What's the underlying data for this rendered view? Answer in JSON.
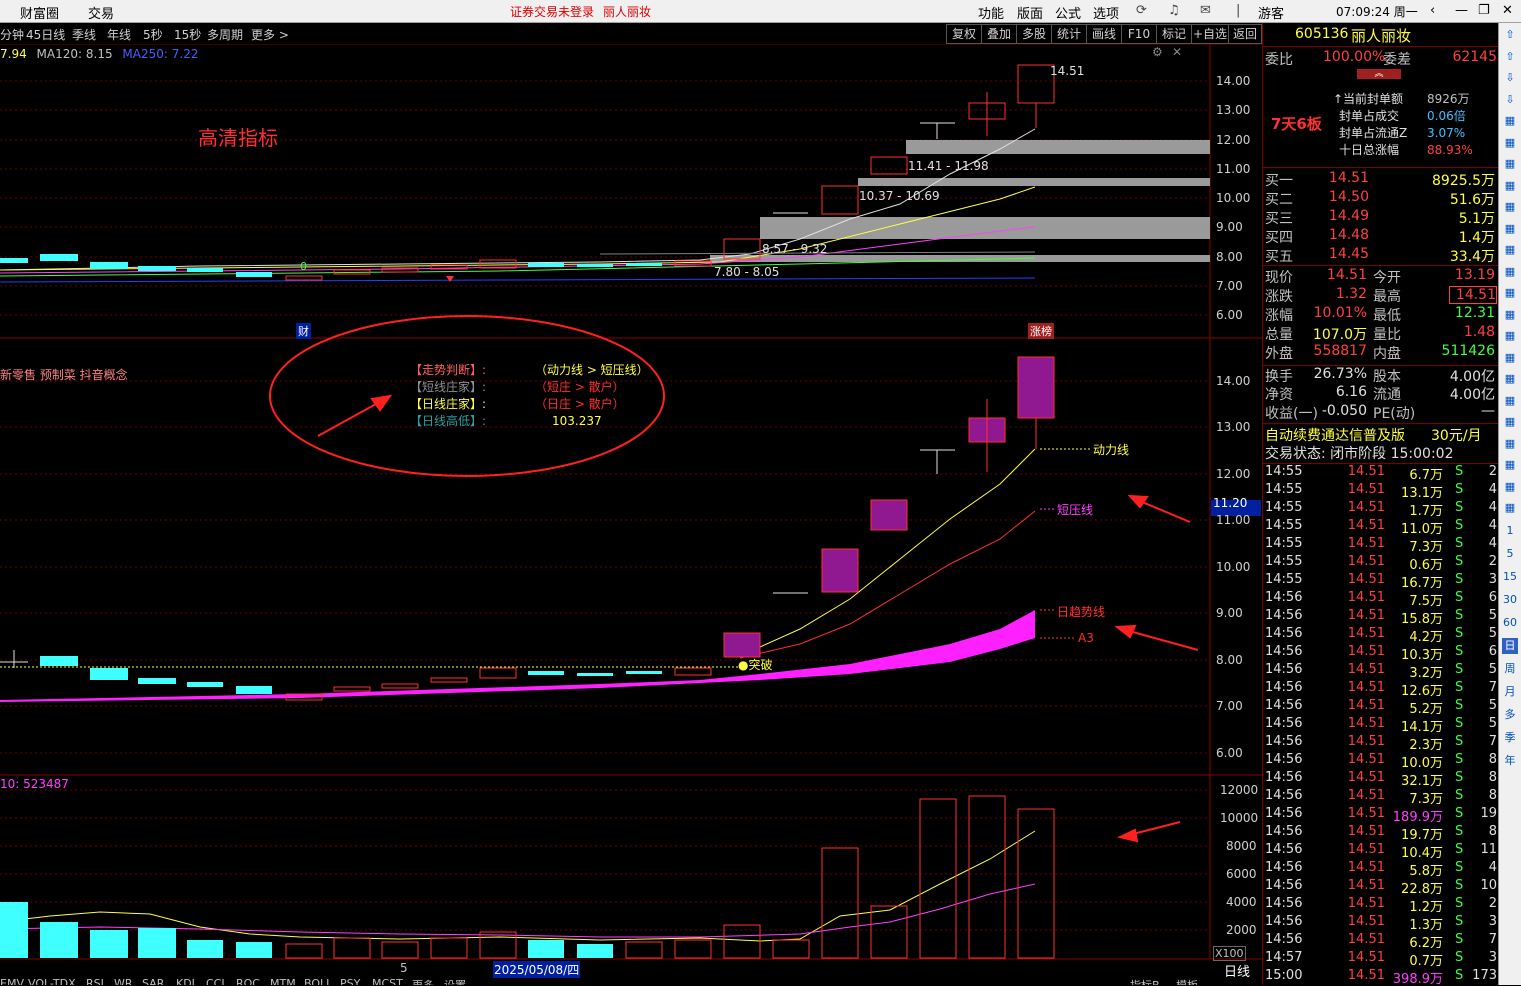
{
  "menu": {
    "left": [
      "财富圈",
      "交易"
    ],
    "alert": "证券交易未登录",
    "stock_name_top": "丽人丽妆",
    "right": [
      "功能",
      "版面",
      "公式",
      "选项"
    ],
    "user": "游客",
    "clock": "07:09:24 周一"
  },
  "toolbar": {
    "periods": [
      "分钟",
      "45日线",
      "季线",
      "年线",
      "5秒",
      "15秒",
      "多周期",
      "更多 >"
    ],
    "buttons": [
      "复权",
      "叠加",
      "多股",
      "统计",
      "画线",
      "F10",
      "标记",
      "+自选",
      "返回"
    ]
  },
  "main_chart": {
    "ma_legend": [
      {
        "text": "7.94",
        "color": "#ffff40"
      },
      {
        "text": "MA120: 8.15",
        "color": "#c0c0c0"
      },
      {
        "text": "MA250: 7.22",
        "color": "#4060ff"
      }
    ],
    "watermark": "高清指标",
    "high_label": "14.51",
    "zones": [
      "11.41 - 11.98",
      "10.37 - 10.69",
      "8.57 - 9.32",
      "7.80 - 8.05"
    ],
    "y_ticks": [
      "14.00",
      "13.00",
      "12.00",
      "11.00",
      "10.00",
      "9.00",
      "8.00",
      "7.00",
      "6.00"
    ],
    "event_cai": "财",
    "event_zhang": "涨榜"
  },
  "indicator_chart": {
    "concepts": "新零售 预制菜 抖音概念",
    "rows": [
      {
        "label": "【走势判断】:",
        "value": "（动力线 > 短压线）",
        "lc": "#ff6060",
        "vc": "#ffff40"
      },
      {
        "label": "【短线庄家】:",
        "value": "（短庄 > 散户）",
        "lc": "#909090",
        "vc": "#ff3030"
      },
      {
        "label": "【日线庄家】:",
        "value": "（日庄 > 散户）",
        "lc": "#ffff40",
        "vc": "#ff3030"
      },
      {
        "label": "【日线高低】:",
        "value": "103.237",
        "lc": "#30a0a0",
        "vc": "#ffff40"
      }
    ],
    "labels": {
      "dongli": "动力线",
      "duanya": "短压线",
      "rishi": "日趋势线",
      "a3": "A3",
      "tupo": "突破"
    },
    "price_tag": "11.20",
    "y_ticks": [
      "14.00",
      "13.00",
      "12.00",
      "11.00",
      "10.00",
      "9.00",
      "8.00",
      "7.00",
      "6.00"
    ]
  },
  "volume_chart": {
    "legend": "10: 523487",
    "y_ticks": [
      "12000",
      "10000",
      "8000",
      "6000",
      "4000",
      "2000"
    ],
    "unit": "X100",
    "date_marker": "2025/05/08/四",
    "month_marker": "5",
    "period": "日线",
    "bottom_tabs": [
      "EMV",
      "VOL-TDX",
      "RSI",
      "WR",
      "SAR",
      "KDJ",
      "CCI",
      "ROC",
      "MTM",
      "BOLL",
      "PSY",
      "MCST",
      "更多",
      "设置"
    ],
    "bottom_right": [
      "指标B",
      "模板"
    ]
  },
  "quote": {
    "code": "605136",
    "name": "丽人丽妆",
    "weibi_label": "委比",
    "weibi": "100.00%",
    "weicha_label": "委差",
    "weicha": "62145",
    "streak": "7天6板",
    "seal": [
      {
        "label": "↑当前封单额",
        "value": "8926万",
        "vc": "#c0c0c0"
      },
      {
        "label": "封单占成交",
        "value": "0.06倍",
        "vc": "#40c0ff"
      },
      {
        "label": "封单占流通Z",
        "value": "3.07%",
        "vc": "#40c0ff"
      },
      {
        "label": "十日总涨幅",
        "value": "88.93%",
        "vc": "#ff4040"
      }
    ],
    "bids": [
      {
        "label": "买一",
        "price": "14.51",
        "vol": "8925.5万"
      },
      {
        "label": "买二",
        "price": "14.50",
        "vol": "51.6万"
      },
      {
        "label": "买三",
        "price": "14.49",
        "vol": "5.1万"
      },
      {
        "label": "买四",
        "price": "14.48",
        "vol": "1.4万"
      },
      {
        "label": "买五",
        "price": "14.45",
        "vol": "33.4万"
      }
    ],
    "stats": [
      {
        "l1": "现价",
        "v1": "14.51",
        "c1": "#ff4040",
        "l2": "今开",
        "v2": "13.19",
        "c2": "#ff4040"
      },
      {
        "l1": "涨跌",
        "v1": "1.32",
        "c1": "#ff4040",
        "l2": "最高",
        "v2": "14.51",
        "c2": "#ff4040"
      },
      {
        "l1": "涨幅",
        "v1": "10.01%",
        "c1": "#ff4040",
        "l2": "最低",
        "v2": "12.31",
        "c2": "#40ff40"
      },
      {
        "l1": "总量",
        "v1": "107.0万",
        "c1": "#ffff40",
        "l2": "量比",
        "v2": "1.48",
        "c2": "#ff4040"
      },
      {
        "l1": "外盘",
        "v1": "558817",
        "c1": "#ff4040",
        "l2": "内盘",
        "v2": "511426",
        "c2": "#40ff40"
      },
      {
        "l1": "换手",
        "v1": "26.73%",
        "c1": "#e0e0e0",
        "l2": "股本",
        "v2": "4.00亿",
        "c2": "#e0e0e0"
      },
      {
        "l1": "净资",
        "v1": "6.16",
        "c1": "#e0e0e0",
        "l2": "流通",
        "v2": "4.00亿",
        "c2": "#e0e0e0"
      },
      {
        "l1": "收益(一)",
        "v1": "-0.050",
        "c1": "#e0e0e0",
        "l2": "PE(动)",
        "v2": "—",
        "c2": "#e0e0e0"
      }
    ],
    "promo": "自动续费通达信普及版",
    "promo_price": "30元/月",
    "status": "交易状态: 闭市阶段 15:00:02"
  },
  "ticks": [
    [
      "14:55",
      "14.51",
      "6.7万",
      "S",
      "2"
    ],
    [
      "14:55",
      "14.51",
      "13.1万",
      "S",
      "4"
    ],
    [
      "14:55",
      "14.51",
      "1.7万",
      "S",
      "4"
    ],
    [
      "14:55",
      "14.51",
      "11.0万",
      "S",
      "4"
    ],
    [
      "14:55",
      "14.51",
      "7.3万",
      "S",
      "4"
    ],
    [
      "14:55",
      "14.51",
      "0.6万",
      "S",
      "2"
    ],
    [
      "14:55",
      "14.51",
      "16.7万",
      "S",
      "3"
    ],
    [
      "14:56",
      "14.51",
      "7.5万",
      "S",
      "6"
    ],
    [
      "14:56",
      "14.51",
      "15.8万",
      "S",
      "5"
    ],
    [
      "14:56",
      "14.51",
      "4.2万",
      "S",
      "5"
    ],
    [
      "14:56",
      "14.51",
      "10.3万",
      "S",
      "6"
    ],
    [
      "14:56",
      "14.51",
      "3.2万",
      "S",
      "5"
    ],
    [
      "14:56",
      "14.51",
      "12.6万",
      "S",
      "7"
    ],
    [
      "14:56",
      "14.51",
      "5.2万",
      "S",
      "5"
    ],
    [
      "14:56",
      "14.51",
      "14.1万",
      "S",
      "5"
    ],
    [
      "14:56",
      "14.51",
      "2.3万",
      "S",
      "7"
    ],
    [
      "14:56",
      "14.51",
      "10.0万",
      "S",
      "8"
    ],
    [
      "14:56",
      "14.51",
      "32.1万",
      "S",
      "8"
    ],
    [
      "14:56",
      "14.51",
      "7.3万",
      "S",
      "8"
    ],
    [
      "14:56",
      "14.51",
      "189.9万",
      "S",
      "19"
    ],
    [
      "14:56",
      "14.51",
      "19.7万",
      "S",
      "8"
    ],
    [
      "14:56",
      "14.51",
      "10.4万",
      "S",
      "11"
    ],
    [
      "14:56",
      "14.51",
      "5.8万",
      "S",
      "4"
    ],
    [
      "14:56",
      "14.51",
      "22.8万",
      "S",
      "10"
    ],
    [
      "14:56",
      "14.51",
      "1.2万",
      "S",
      "2"
    ],
    [
      "14:56",
      "14.51",
      "1.3万",
      "S",
      "3"
    ],
    [
      "14:56",
      "14.51",
      "6.2万",
      "S",
      "7"
    ],
    [
      "14:57",
      "14.51",
      "0.7万",
      "S",
      "3"
    ],
    [
      "15:00",
      "14.51",
      "398.9万",
      "S",
      "173"
    ]
  ],
  "strip_icons": [
    "up-arrow",
    "up-arrow",
    "down-arrow",
    "down-arrow",
    "chart",
    "chart",
    "chart",
    "chart",
    "chart",
    "chart",
    "chart",
    "chart",
    "chart",
    "chart",
    "chart",
    "chart",
    "chart",
    "chart",
    "chart",
    "chart",
    "chart",
    "chart",
    "chart"
  ],
  "strip_labels": [
    "1",
    "5",
    "15",
    "30",
    "60",
    "日",
    "周",
    "月",
    "多",
    "季",
    "年"
  ],
  "colors": {
    "up": "#ff3030",
    "down": "#40ffff",
    "accent": "#ff00ff"
  }
}
